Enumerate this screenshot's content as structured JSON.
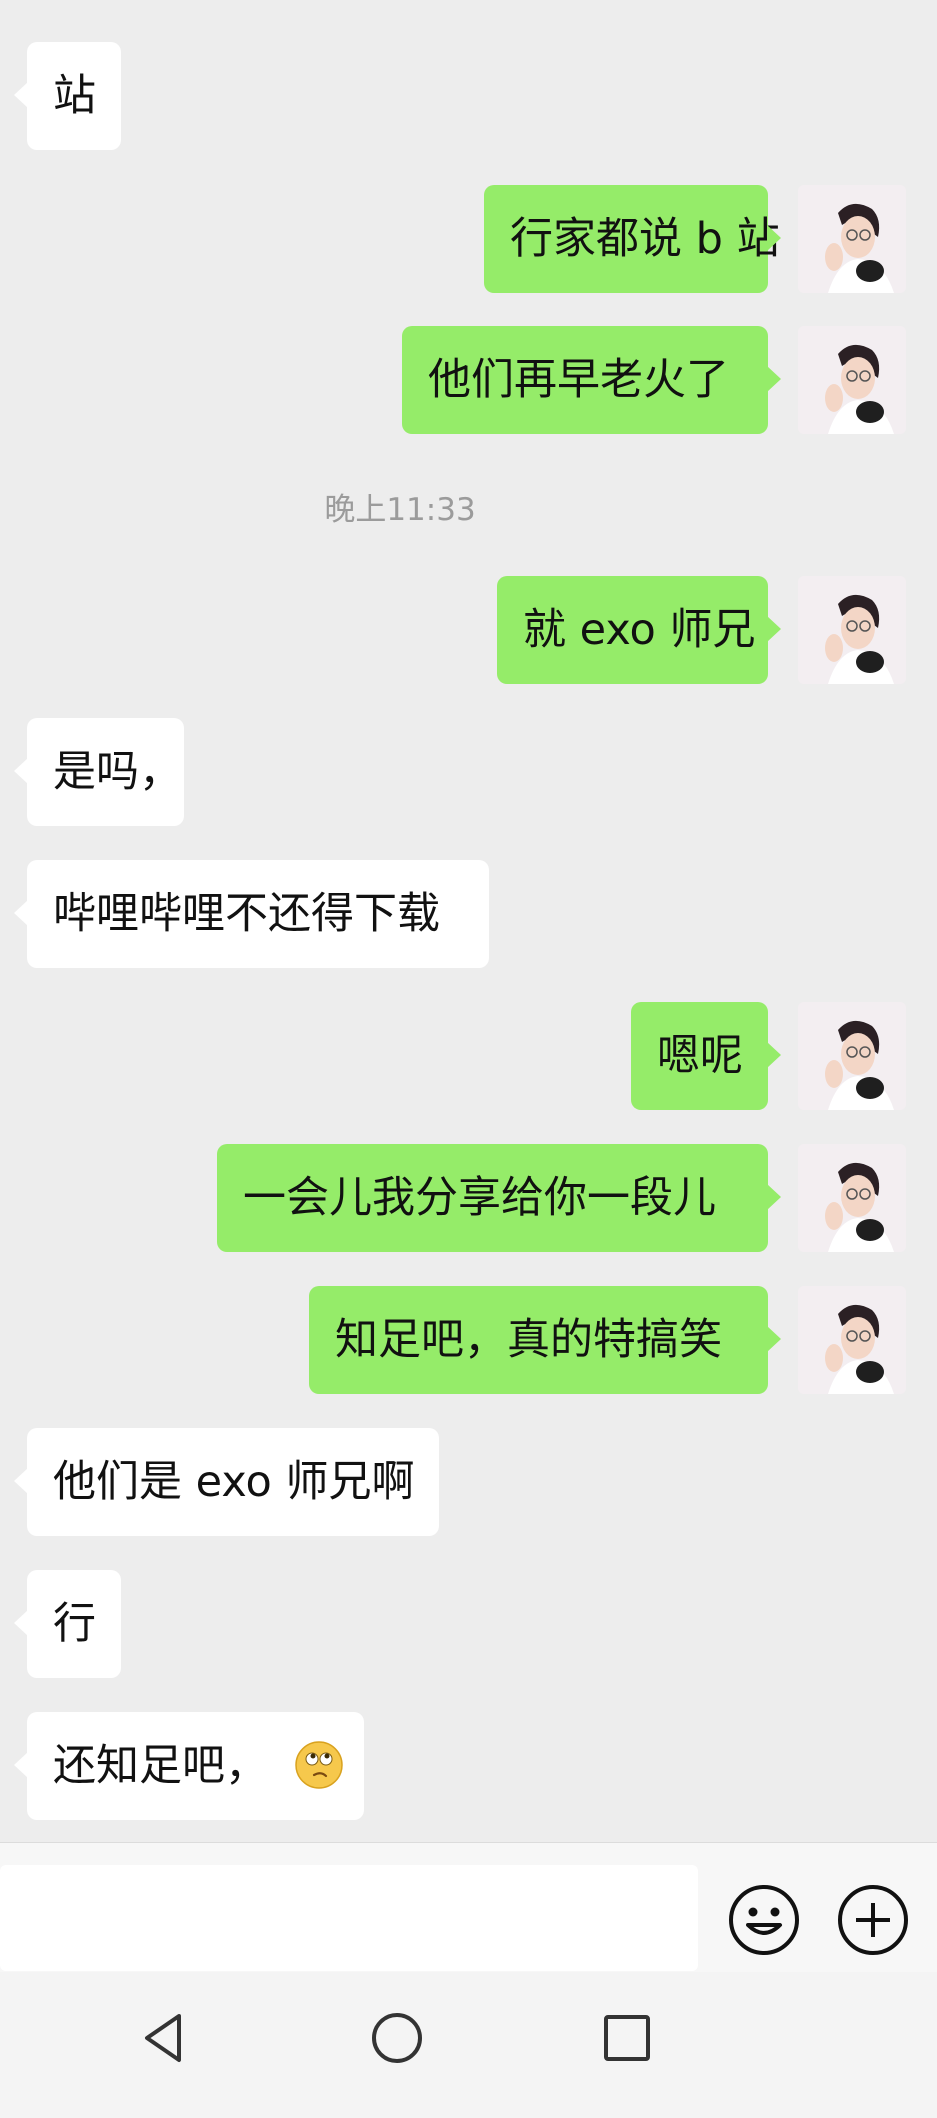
{
  "chat": {
    "timestamp": "晚上11:33",
    "messages": [
      {
        "side": "left",
        "text": "站"
      },
      {
        "side": "right",
        "text": "行家都说 b 站"
      },
      {
        "side": "right",
        "text": "他们再早老火了"
      },
      {
        "side": "right",
        "text": "就 exo 师兄"
      },
      {
        "side": "left",
        "text": "是吗，"
      },
      {
        "side": "left",
        "text": "哔哩哔哩不还得下载"
      },
      {
        "side": "right",
        "text": "嗯呢"
      },
      {
        "side": "right",
        "text": "一会儿我分享给你一段儿"
      },
      {
        "side": "right",
        "text": "知足吧，真的特搞笑"
      },
      {
        "side": "left",
        "text": "他们是 exo 师兄啊"
      },
      {
        "side": "left",
        "text": "行"
      },
      {
        "side": "left",
        "text": "还知足吧，",
        "emoji": "thinking-face-icon"
      }
    ]
  },
  "input_bar": {
    "value": "",
    "emoji_button_icon": "smiley-icon",
    "more_button_icon": "plus-circle-icon"
  },
  "navbar": {
    "back_icon": "triangle-back-icon",
    "home_icon": "circle-home-icon",
    "recents_icon": "square-recents-icon"
  },
  "colors": {
    "background": "#ededed",
    "outgoing_bubble": "#95ec69",
    "incoming_bubble": "#ffffff",
    "timestamp_text": "#9b9b9b"
  }
}
